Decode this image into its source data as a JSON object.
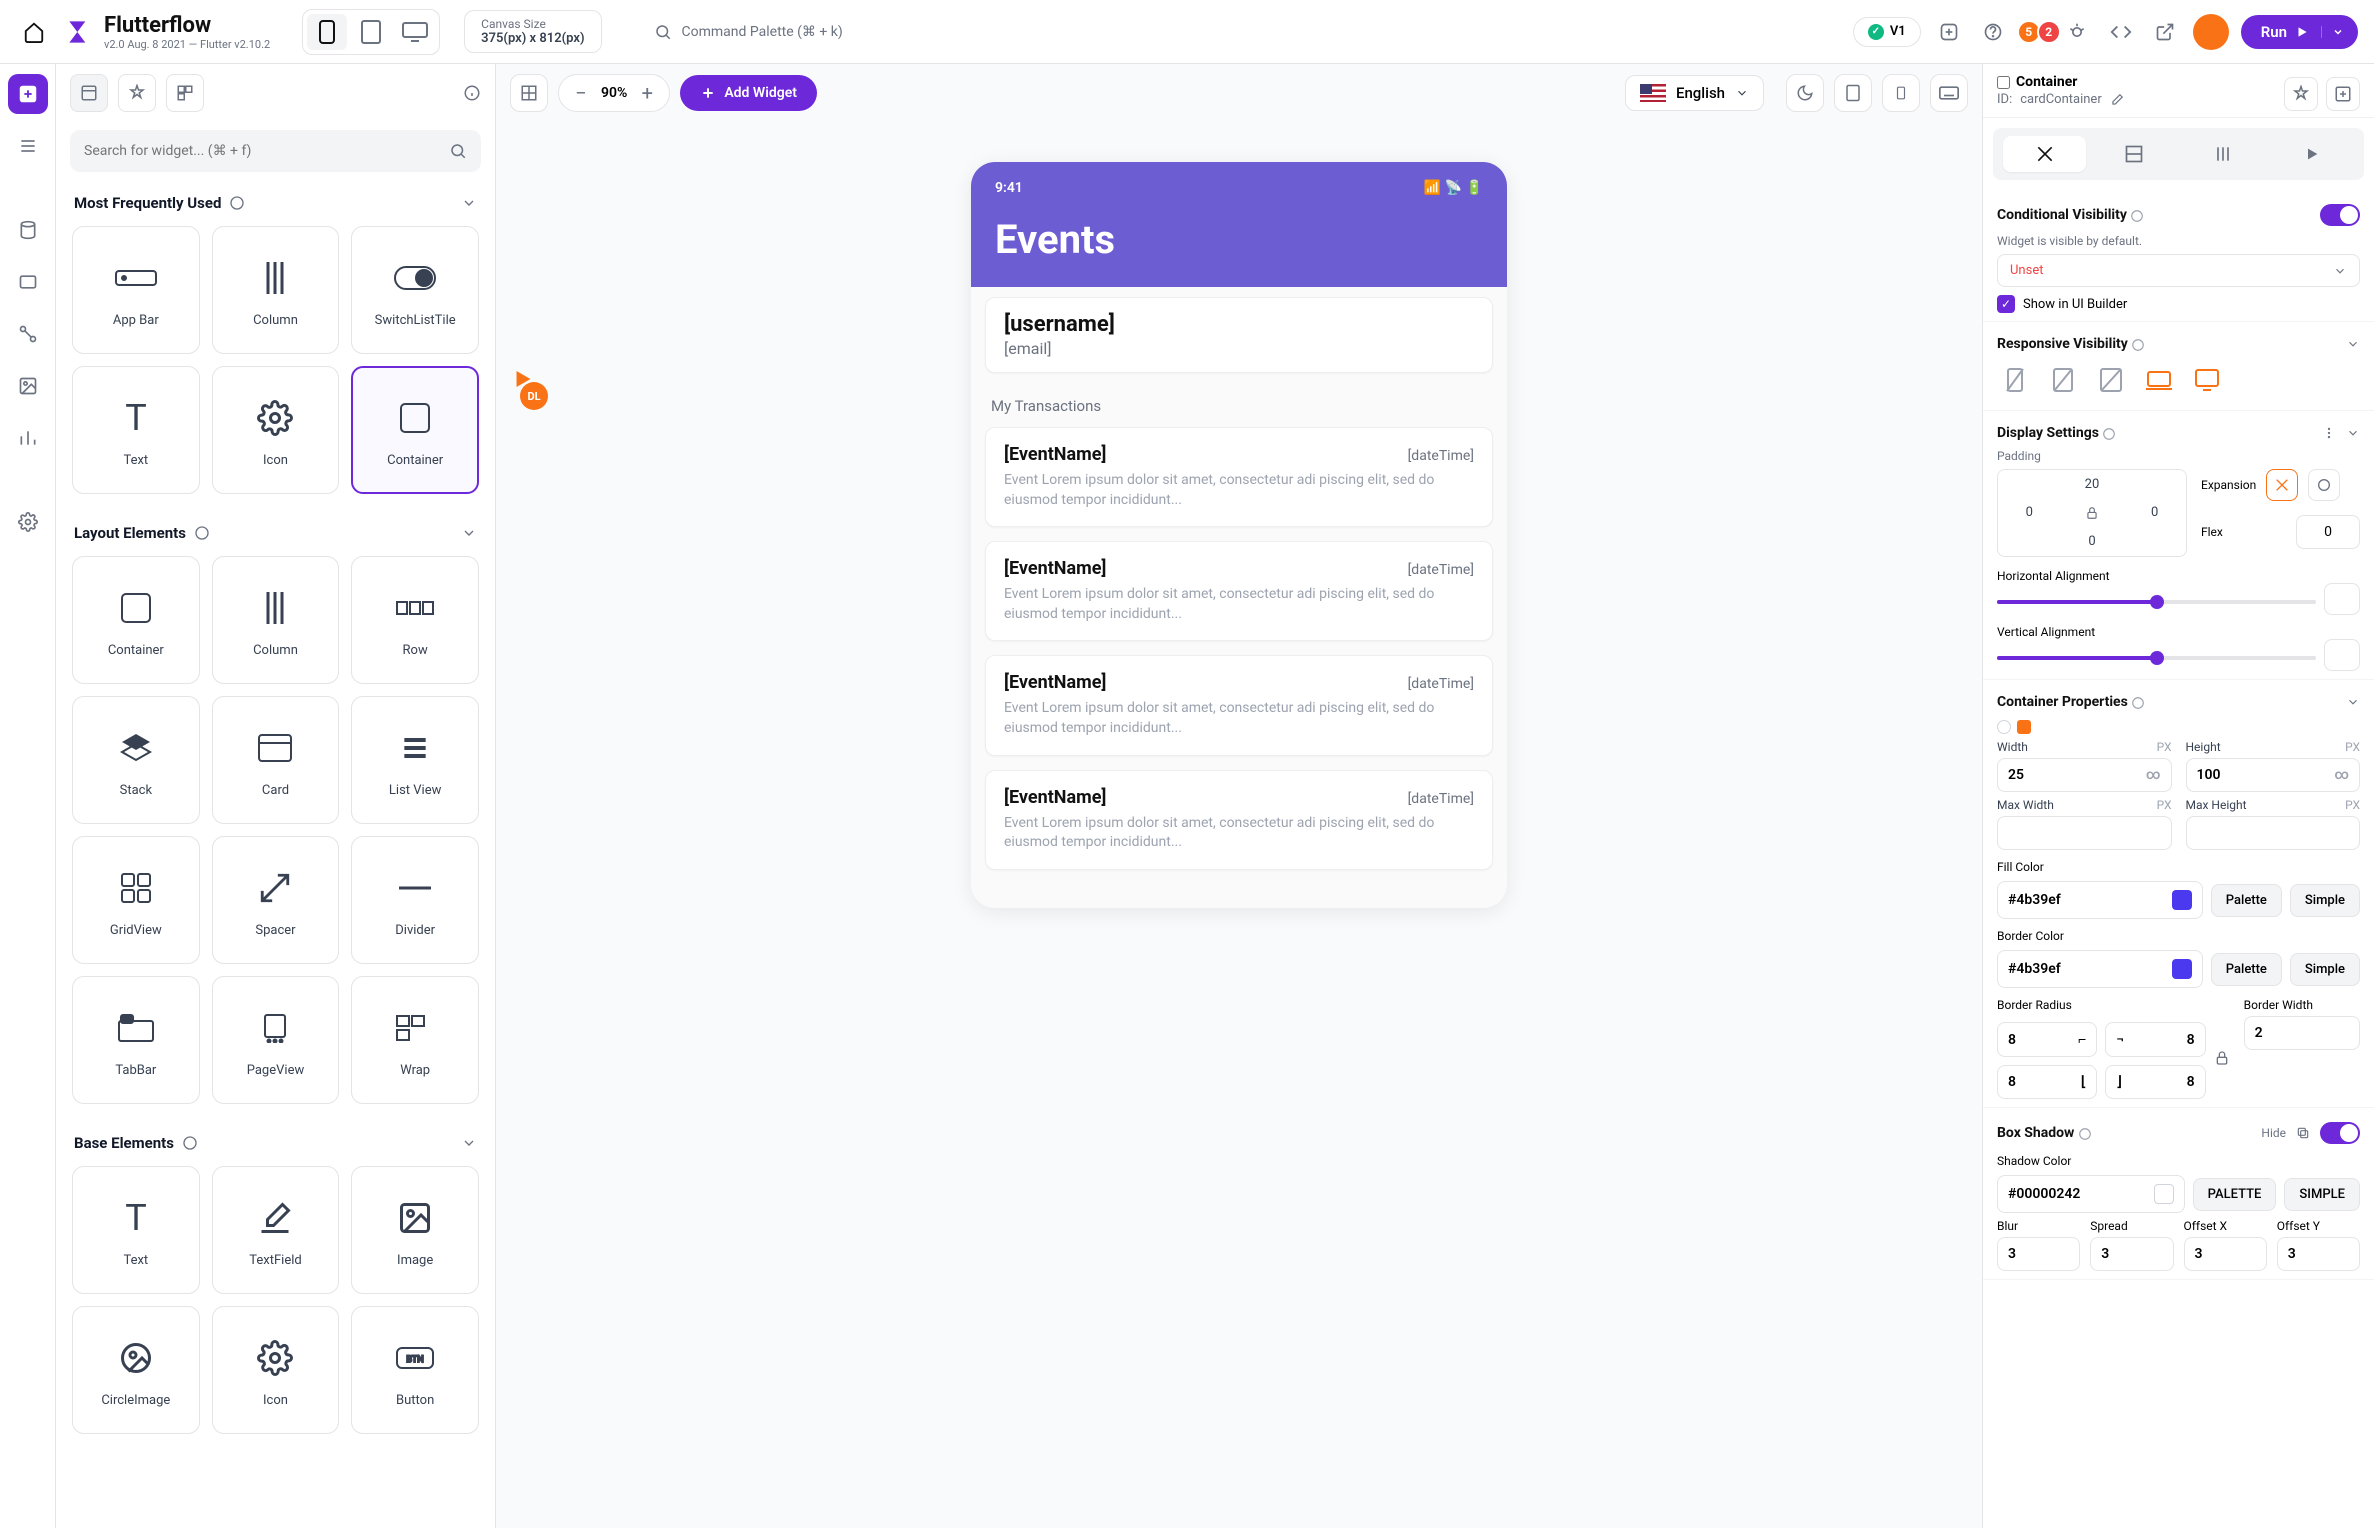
{
  "topbar": {
    "brand_name": "Flutterflow",
    "brand_sub": "v2.0 Aug. 8 2021 — Flutter v2.10.2",
    "canvas_label": "Canvas Size",
    "canvas_value": "375(px) x 812(px)",
    "cmd_placeholder": "Command Palette (⌘ + k)",
    "version": "V1",
    "badge1": "5",
    "badge2": "2",
    "run": "Run"
  },
  "left": {
    "search_placeholder": "Search for widget... (⌘ + f)",
    "sections": {
      "freq": "Most Frequently Used",
      "layout": "Layout Elements",
      "base": "Base Elements"
    },
    "freq_items": [
      "App Bar",
      "Column",
      "SwitchListTile",
      "Text",
      "Icon",
      "Container"
    ],
    "layout_items": [
      "Container",
      "Column",
      "Row",
      "Stack",
      "Card",
      "List View",
      "GridView",
      "Spacer",
      "Divider",
      "TabBar",
      "PageView",
      "Wrap"
    ],
    "base_items": [
      "Text",
      "TextField",
      "Image",
      "CircleImage",
      "Icon",
      "Button"
    ]
  },
  "canvas": {
    "zoom": "90%",
    "add_widget": "Add Widget",
    "language": "English",
    "cursor_user": "DL"
  },
  "phone": {
    "time": "9:41",
    "title": "Events",
    "username": "[username]",
    "email": "[email]",
    "section_label": "My Transactions",
    "events": [
      {
        "name": "[EventName]",
        "date": "[dateTime]",
        "desc": "Event Lorem ipsum dolor sit amet, consectetur adi piscing elit, sed do eiusmod tempor incididunt..."
      },
      {
        "name": "[EventName]",
        "date": "[dateTime]",
        "desc": "Event Lorem ipsum dolor sit amet, consectetur adi piscing elit, sed do eiusmod tempor incididunt..."
      },
      {
        "name": "[EventName]",
        "date": "[dateTime]",
        "desc": "Event Lorem ipsum dolor sit amet, consectetur adi piscing elit, sed do eiusmod tempor incididunt..."
      },
      {
        "name": "[EventName]",
        "date": "[dateTime]",
        "desc": "Event Lorem ipsum dolor sit amet, consectetur adi piscing elit, sed do eiusmod tempor incididunt..."
      }
    ]
  },
  "right": {
    "type": "Container",
    "id_label": "ID:",
    "id": "cardContainer",
    "cond_vis_label": "Conditional Visibility",
    "cond_vis_sub": "Widget is visible by default.",
    "cond_vis_value": "Unset",
    "show_builder": "Show in UI Builder",
    "resp_vis_label": "Responsive Visibility",
    "display_label": "Display Settings",
    "padding_label": "Padding",
    "padding": {
      "top": "20",
      "right": "0",
      "bottom": "0",
      "left": "0"
    },
    "expansion_label": "Expansion",
    "flex_label": "Flex",
    "flex_value": "0",
    "h_align": "Horizontal Alignment",
    "v_align": "Vertical Alignment",
    "container_props": "Container Properties",
    "width_label": "Width",
    "width_unit": "PX",
    "width_value": "25",
    "height_label": "Height",
    "height_unit": "PX",
    "height_value": "100",
    "maxw_label": "Max Width",
    "maxh_label": "Max Height",
    "fill_label": "Fill Color",
    "fill_value": "#4b39ef",
    "border_color_label": "Border Color",
    "border_color_value": "#4b39ef",
    "palette": "Palette",
    "simple": "Simple",
    "radius_label": "Border Radius",
    "bwidth_label": "Border Width",
    "radius_tl": "8",
    "radius_tr": "8",
    "radius_bl": "8",
    "radius_br": "8",
    "bwidth": "2",
    "shadow_label": "Box Shadow",
    "hide": "Hide",
    "shadow_color_label": "Shadow Color",
    "shadow_color": "#00000242",
    "palette_caps": "PALETTE",
    "simple_caps": "SIMPLE",
    "blur_label": "Blur",
    "spread_label": "Spread",
    "ox_label": "Offset X",
    "oy_label": "Offset Y",
    "blur": "3",
    "spread": "3",
    "ox": "3",
    "oy": "3"
  }
}
